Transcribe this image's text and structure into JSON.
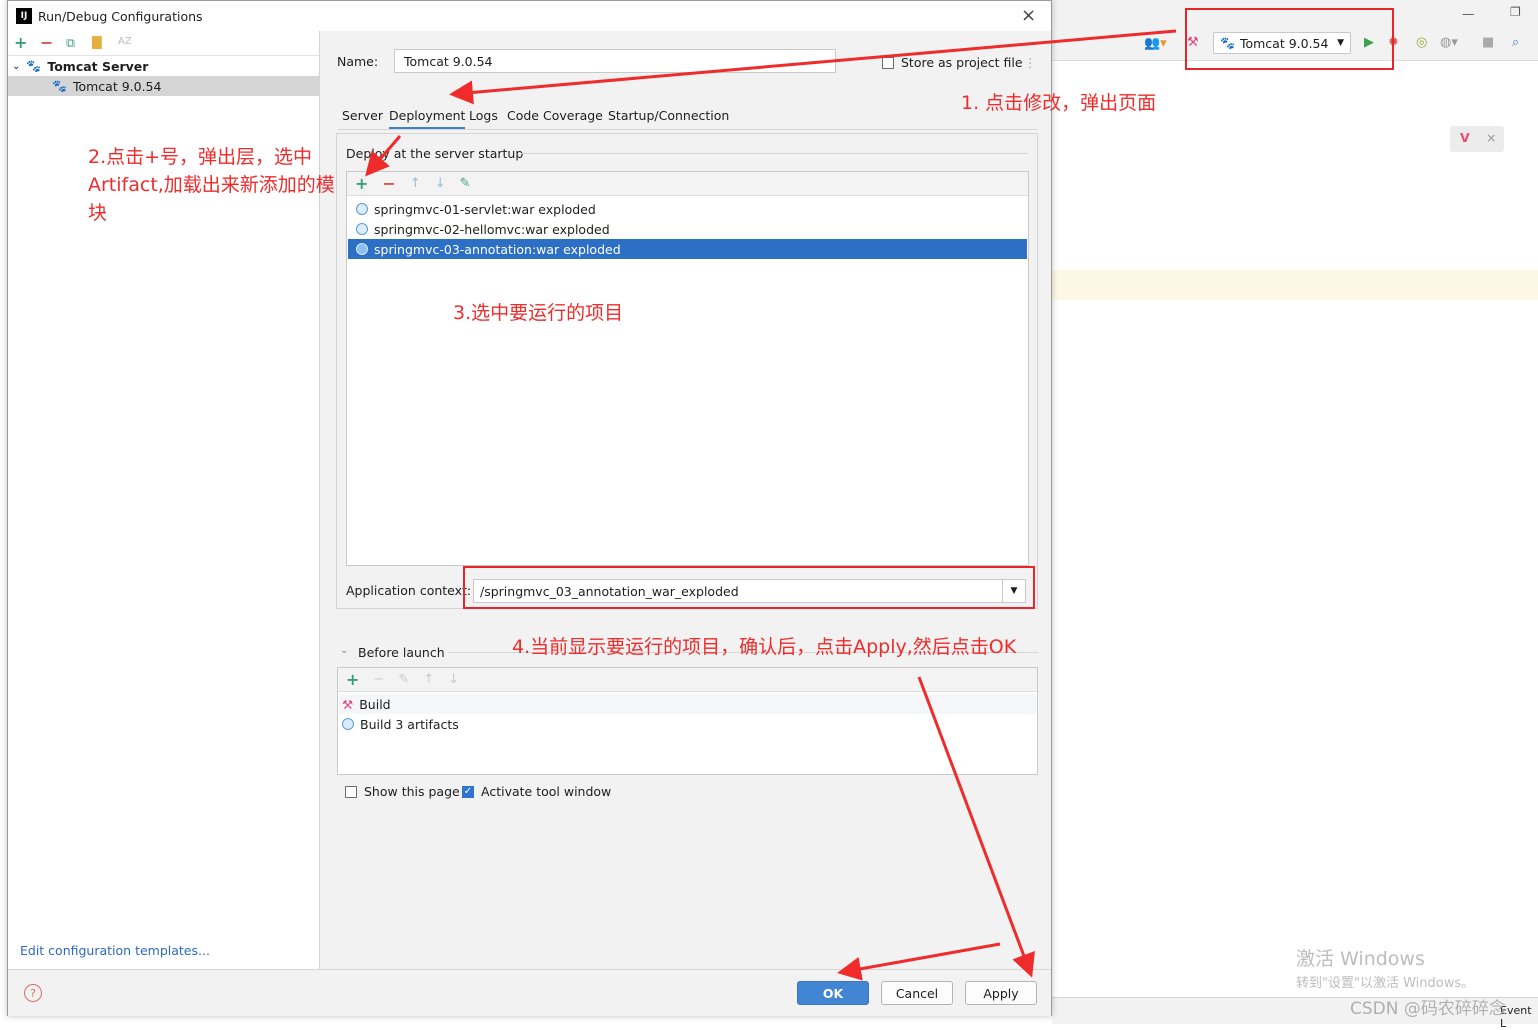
{
  "ide": {
    "run_config": "Tomcat 9.0.54",
    "watermark_line1": "激活 Windows",
    "watermark_line2": "转到\"设置\"以激活 Windows。",
    "csdn": "CSDN @码农碎碎念",
    "event_log": "Event L"
  },
  "dialog": {
    "title": "Run/Debug Configurations",
    "close_glyph": "×",
    "tree": {
      "group": "Tomcat Server",
      "item": "Tomcat 9.0.54"
    },
    "edit_templates": "Edit configuration templates...",
    "name_label": "Name:",
    "name_value": "Tomcat 9.0.54",
    "store_label": "Store as project file",
    "tabs": [
      "Server",
      "Deployment",
      "Logs",
      "Code Coverage",
      "Startup/Connection"
    ],
    "deploy_title": "Deploy at the server startup",
    "artifacts": [
      "springmvc-01-servlet:war exploded",
      "springmvc-02-hellomvc:war exploded",
      "springmvc-03-annotation:war exploded"
    ],
    "context_label": "Application context:",
    "context_value": "/springmvc_03_annotation_war_exploded",
    "before_launch": "Before launch",
    "launch_tasks": [
      "Build",
      "Build 3 artifacts"
    ],
    "show_page": "Show this page",
    "activate_tool": "Activate tool window",
    "buttons": {
      "ok": "OK",
      "cancel": "Cancel",
      "apply": "Apply"
    }
  },
  "annotations": {
    "step1": "1. 点击修改，弹出页面",
    "step2": "2.点击+号，弹出层，选中Artifact,加载出来新添加的模块",
    "step3": "3.选中要运行的项目",
    "step4": "4.当前显示要运行的项目，确认后，点击Apply,然后点击OK"
  },
  "colors": {
    "annotation": "#ef2b2b",
    "selection": "#2d6fc4",
    "ok_button": "#4285d3"
  }
}
